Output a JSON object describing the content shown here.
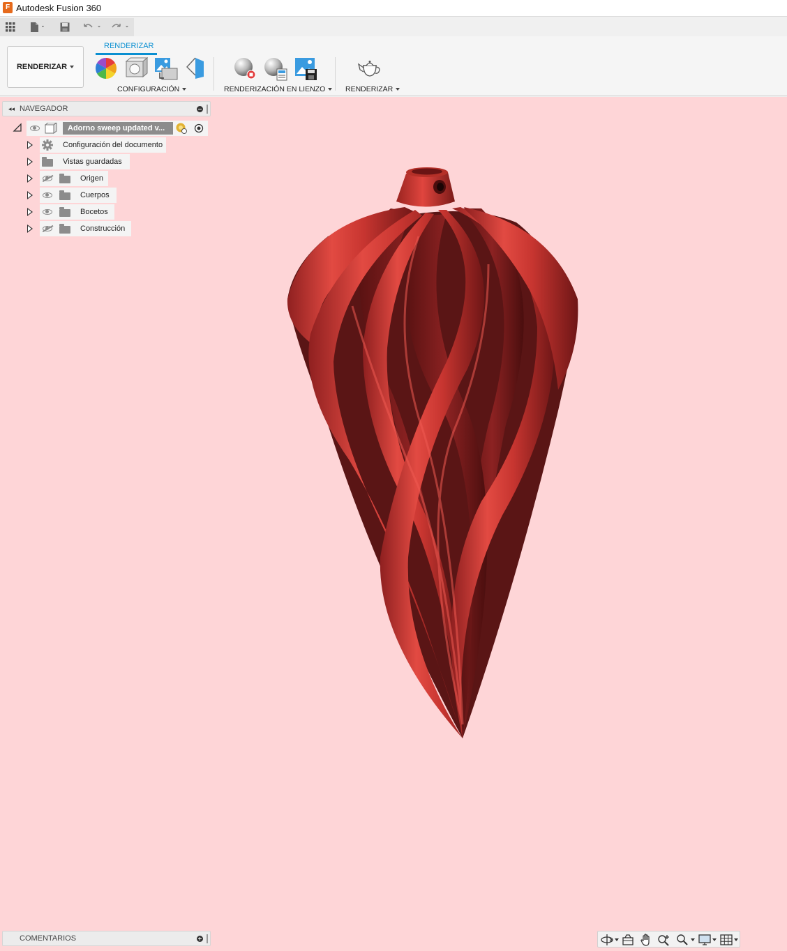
{
  "window": {
    "title": "Autodesk Fusion 360",
    "app_icon_letter": "F"
  },
  "ribbon": {
    "workspace_label": "RENDERIZAR",
    "active_tab": "RENDERIZAR",
    "groups": {
      "configuracion": "CONFIGURACIÓN",
      "lienzo": "RENDERIZACIÓN EN LIENZO",
      "renderizar": "RENDERIZAR"
    },
    "icons": {
      "configuracion": [
        "appearance-icon",
        "physical-materials-icon",
        "scene-settings-icon",
        "texture-map-icon"
      ],
      "lienzo": [
        "in-canvas-render-icon",
        "in-canvas-render-settings-icon",
        "capture-image-icon"
      ],
      "renderizar": [
        "render-teapot-icon"
      ]
    }
  },
  "navigator": {
    "title": "NAVEGADOR",
    "root": {
      "label": "Adorno sweep updated v..."
    },
    "nodes": [
      {
        "label": "Configuración del documento",
        "icon": "gear-icon",
        "eye": null
      },
      {
        "label": "Vistas guardadas",
        "icon": "folder-icon",
        "eye": null
      },
      {
        "label": "Origen",
        "icon": "folder-icon",
        "eye": "hidden"
      },
      {
        "label": "Cuerpos",
        "icon": "folder-icon",
        "eye": "visible"
      },
      {
        "label": "Bocetos",
        "icon": "folder-icon",
        "eye": "visible"
      },
      {
        "label": "Construcción",
        "icon": "folder-icon",
        "eye": "hidden"
      }
    ]
  },
  "comments": {
    "title": "COMENTARIOS"
  },
  "viewport": {
    "background_color": "#fed5d7",
    "model_color": "#d7423c"
  },
  "navbar": {
    "tools": [
      "orbit-icon",
      "look-at-icon",
      "pan-icon",
      "zoom-icon",
      "fit-icon",
      "display-settings-icon",
      "grid-settings-icon"
    ]
  }
}
